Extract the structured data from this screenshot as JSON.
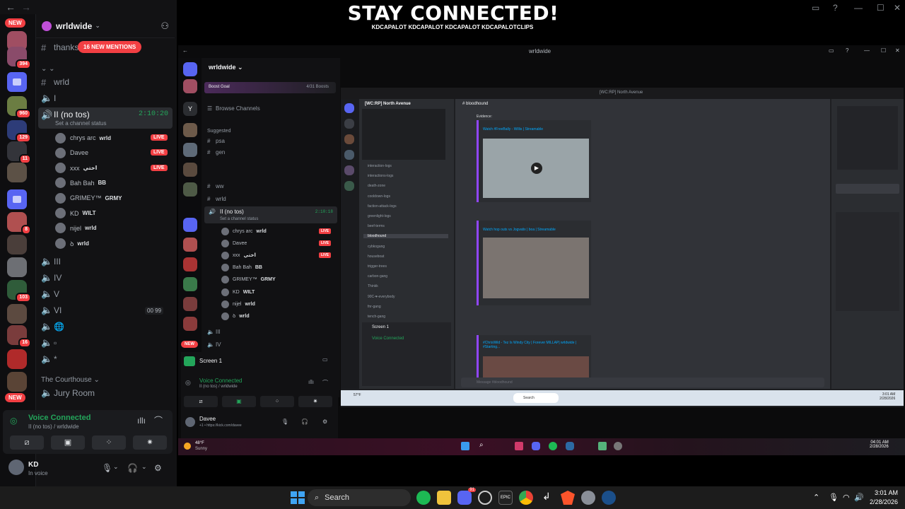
{
  "banner": {
    "title": "STAY CONNECTED!",
    "socials": "KDCAPALOT  KDCAPALOT  KDCAPALOT  KDCAPALOTCLIPS"
  },
  "left": {
    "server_badges": [
      "394",
      "960",
      "129",
      "11",
      "8",
      "103",
      "16"
    ],
    "new_label": "NEW",
    "guild": "wrldwide",
    "thanks_channel": "thanks",
    "mentions": "16 NEW MENTIONS",
    "channels": [
      "wrld",
      "I",
      "II (no tos)"
    ],
    "active_time": "2:10:20",
    "status_hint": "Set a channel status",
    "members": [
      {
        "name": "chrys arc",
        "tag": "wrld",
        "live": true
      },
      {
        "name": "Davee",
        "tag": "",
        "live": true
      },
      {
        "name": "xxx",
        "tag": "اختي",
        "live": true
      },
      {
        "name": "Bah Bah",
        "tag": "BB",
        "live": false
      },
      {
        "name": "GRIMEY™",
        "tag": "GRMY",
        "live": false
      },
      {
        "name": "KD",
        "tag": "WILT",
        "live": false
      },
      {
        "name": "nijel",
        "tag": "wrld",
        "live": false
      },
      {
        "name": "ꝺ",
        "tag": "wrld",
        "live": false
      }
    ],
    "live_label": "LIVE",
    "voice_channels": [
      "III",
      "IV",
      "V",
      "VI"
    ],
    "vi_counts": "00 99",
    "category": "The Courthouse",
    "jury_room": "Jury Room",
    "voice_connected": "Voice Connected",
    "voice_sub": "II (no tos) / wrldwide",
    "user_name": "KD",
    "user_status": "In voice"
  },
  "mid": {
    "title": "wrldwide",
    "guild": "wrldwide",
    "boost_goal": "Boost Goal",
    "boost_count": "4/31 Boosts",
    "browse": "Browse Channels",
    "suggested": "Suggested",
    "suggested_channels": [
      "psa",
      "gen"
    ],
    "channels": [
      "ww",
      "wrld",
      "II (no tos)"
    ],
    "active_time": "2:10:18",
    "status_hint": "Set a channel status",
    "members": [
      {
        "name": "chrys arc",
        "tag": "wrld",
        "live": true
      },
      {
        "name": "Davee",
        "tag": "",
        "live": true
      },
      {
        "name": "xxx",
        "tag": "اختي",
        "live": true
      },
      {
        "name": "Bah Bah",
        "tag": "BB",
        "live": false
      },
      {
        "name": "GRIMEY™",
        "tag": "GRMY",
        "live": false
      },
      {
        "name": "KD",
        "tag": "WILT",
        "live": false
      },
      {
        "name": "nijel",
        "tag": "wrld",
        "live": false
      },
      {
        "name": "ꝺ",
        "tag": "wrld",
        "live": false
      }
    ],
    "live_label": "LIVE",
    "more_channels": [
      "III",
      "IV"
    ],
    "new_label": "NEW",
    "screen_title": "Screen 1",
    "voice_connected": "Voice Connected",
    "voice_sub": "II (no tos) / wrldwide",
    "user_name": "Davee",
    "user_status": "+1 • https://kick.com/davee",
    "weather_temp": "48°F",
    "weather_desc": "Sunny",
    "clock_time": "04:01 AM",
    "clock_date": "2/28/2026"
  },
  "inner": {
    "server_name": "[WC:RP] North Avenue",
    "channel_name": "bloodhound",
    "channels": [
      "interaction-logs",
      "interactions-logs",
      "death-zone",
      "cooldown-logs",
      "faction-attack-logs",
      "greenlight-logs",
      "beef-terms",
      "bloodhound",
      "cybkogang",
      "houseboat",
      "trigger-trees",
      "carbon-gang",
      "Thinkk",
      "90C-♥-everybody",
      "fnr-gang",
      "tench-gang"
    ],
    "evidence": "Evidence:",
    "embed1_title": "Watch #FreeBally - Willis | Streamable",
    "embed2_title": "Watch hop outs vs Jogvatix | boa | Streamable",
    "embed3_title": "#ChrisWild - Tez Is Windy City | Forever MILLAP| wrldwide | #Starting...",
    "message_placeholder": "Message #bloodhound",
    "screen_title": "Screen 1",
    "voice_connected": "Voice Connected",
    "taskbar_search": "Search",
    "taskbar_time": "3:01 AM",
    "taskbar_date": "2/28/2026",
    "weather": "57°F"
  },
  "taskbar": {
    "search": "Search",
    "time": "3:01 AM",
    "date": "2/28/2026",
    "discord_badge": "91"
  },
  "colors": {
    "accent_red": "#f23f43",
    "voice_green": "#23a55a",
    "blurple": "#5865f2"
  }
}
